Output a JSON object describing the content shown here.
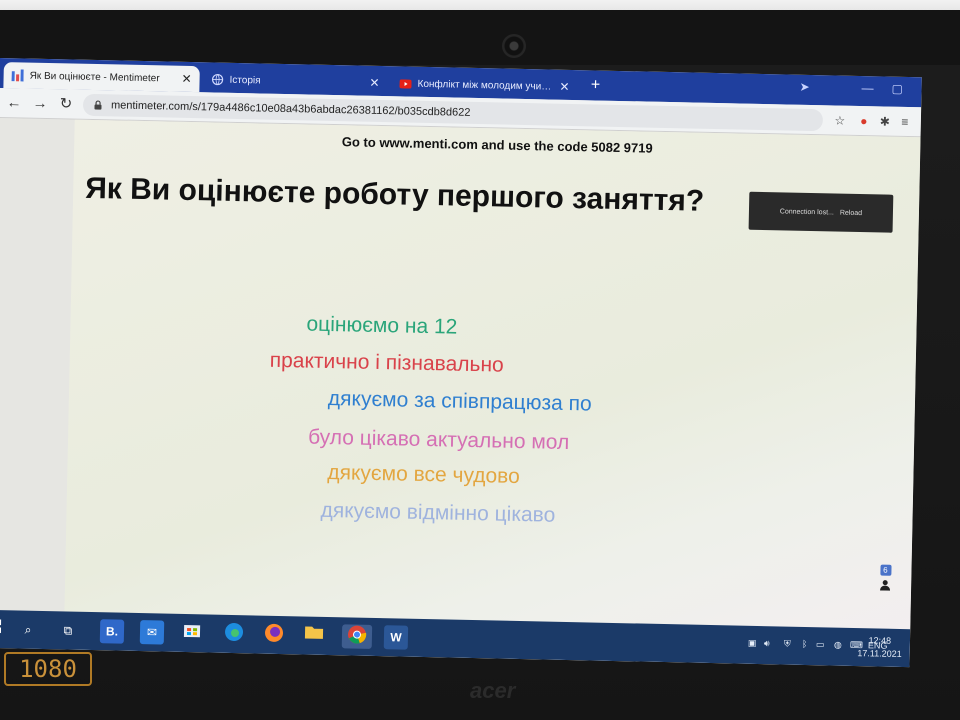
{
  "browser": {
    "tabs": [
      {
        "label": "Як Ви оцінюєте - Mentimeter",
        "favicon": "mentimeter-logo-icon",
        "active": true
      },
      {
        "label": "Історія",
        "favicon": "history-globe-icon",
        "active": false
      },
      {
        "label": "Конфлікт між молодим учителем",
        "favicon": "youtube-icon",
        "active": false
      }
    ],
    "url": "mentimeter.com/s/179a4486c10e08a43b6abdac26381162/b035cdb8d622"
  },
  "slide": {
    "join_instructions": "Go to www.menti.com and use the code 5082 9719",
    "question": "Як Ви оцінюєте роботу першого заняття?",
    "connection_notice": "Connection lost...",
    "reload_label": "Reload",
    "responses": [
      {
        "text": "оцінюємо на 12",
        "color": "#2aa57a"
      },
      {
        "text": "практично і пізнавально",
        "color": "#d9424a"
      },
      {
        "text": "дякуємо за співпрацюза по",
        "color": "#2f7fd0"
      },
      {
        "text": "було цікаво актуально мол",
        "color": "#d56fb4"
      },
      {
        "text": "дякуємо все чудово",
        "color": "#e3a640"
      },
      {
        "text": "дякуємо відмінно цікаво",
        "color": "#9fb3de"
      }
    ],
    "participant_count": "6"
  },
  "taskbar": {
    "apps": [
      "start-icon",
      "search-icon",
      "task-view-icon",
      "b-app-icon",
      "mail-icon",
      "store-icon",
      "edge-icon",
      "firefox-icon",
      "file-explorer-icon",
      "chrome-icon",
      "word-icon"
    ],
    "language": "ENG",
    "time": "12:48",
    "date": "17.11.2021"
  },
  "bezel": {
    "resolution_badge": "1080",
    "brand": "acer"
  }
}
